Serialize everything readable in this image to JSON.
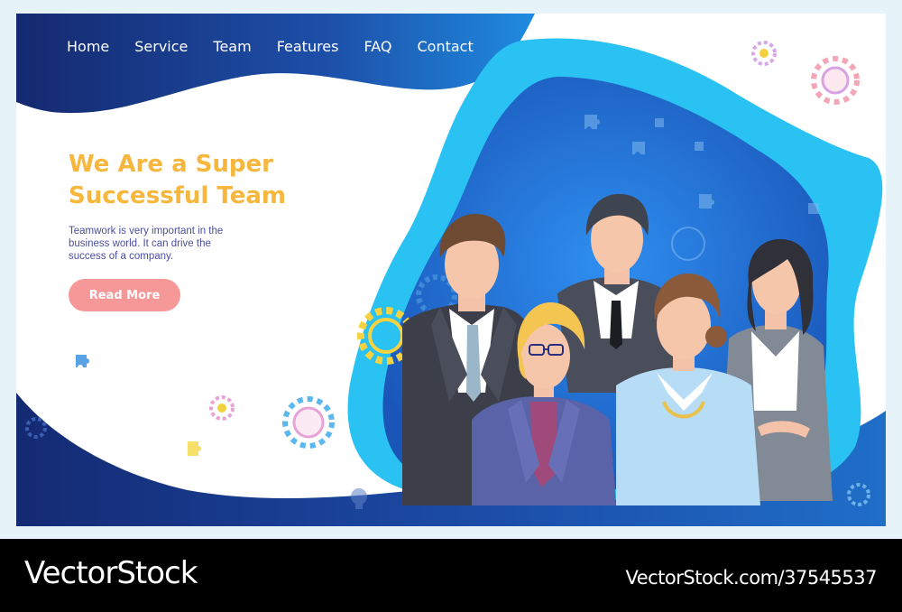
{
  "nav": {
    "items": [
      {
        "label": "Home"
      },
      {
        "label": "Service"
      },
      {
        "label": "Team"
      },
      {
        "label": "Features"
      },
      {
        "label": "FAQ"
      },
      {
        "label": "Contact"
      }
    ]
  },
  "hero": {
    "title_line1": "We Are a Super",
    "title_line2": "Successful Team",
    "text_line1": "Teamwork is very important in the",
    "text_line2": "business world. It can drive the",
    "text_line3": "success of a company.",
    "button_label": "Read More"
  },
  "illustration": {
    "icons": [
      "gear-icon",
      "puzzle-piece-icon",
      "lightbulb-icon",
      "refresh-icon"
    ],
    "people": [
      "man-in-dark-suit",
      "man-with-striped-tie",
      "woman-with-glasses",
      "woman-in-blue-blouse",
      "woman-in-gray-jacket"
    ]
  },
  "footer": {
    "brand": "VectorStock",
    "stock_id": "VectorStock.com/37545537"
  },
  "colors": {
    "navy": "#16307c",
    "blue": "#1f7fd6",
    "cyan": "#28c1f0",
    "title_yellow": "#f6b73c",
    "button_pink": "#f79898",
    "body_text": "#4a4fa0"
  }
}
